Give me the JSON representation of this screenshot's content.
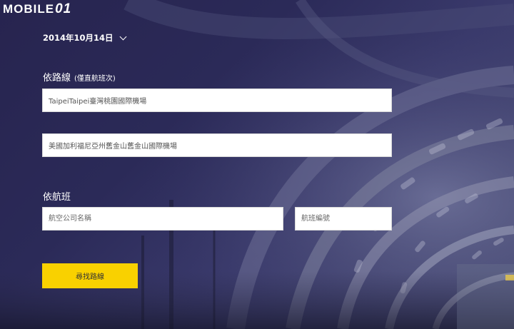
{
  "logo": {
    "text": "MOBILE",
    "suffix": "01"
  },
  "date_selector": {
    "value": "2014年10月14日"
  },
  "route_section": {
    "title": "依路線",
    "note": "(僅直航班次)",
    "origin_value": "TaipeiTaipei臺灣桃園國際機場",
    "destination_value": "美國加利福尼亞州舊金山舊金山國際機場"
  },
  "flight_section": {
    "title": "依航班",
    "airline_placeholder": "航空公司名稱",
    "flight_number_placeholder": "航班編號"
  },
  "search_button": {
    "label": "尋找路線"
  },
  "colors": {
    "accent": "#f9d100",
    "background": "#2b2a58"
  },
  "icons": {
    "date_dropdown": "chevron-down-icon"
  }
}
